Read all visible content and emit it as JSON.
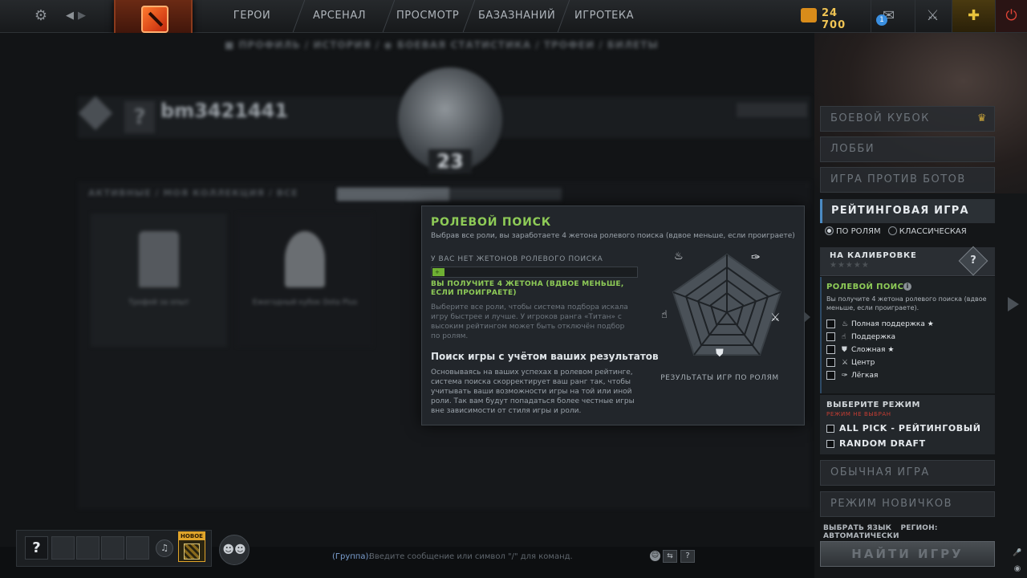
{
  "topbar": {
    "nav": [
      "ГЕРОИ",
      "АРСЕНАЛ",
      "ПРОСМОТР",
      "БАЗАЗНАНИЙ",
      "ИГРОТЕКА"
    ],
    "gold": "24 700",
    "notification_count": "1",
    "icons": {
      "settings": "gear-icon",
      "back": "back-arrow-icon",
      "forward": "forward-arrow-icon",
      "gold": "shards-icon",
      "mail": "mail-icon",
      "armory": "armory-icon",
      "plus": "dota-plus-icon",
      "power": "power-icon"
    }
  },
  "profile": {
    "subnav": "■ ПРОФИЛЬ / ИСТОРИЯ / ◉ БОЕВАЯ СТАТИСТИКА / ТРОФЕИ / БИЛЕТЫ",
    "username": "bm3421441",
    "avatar": "?",
    "rank_number": "23",
    "tabs": "АКТИВНЫЕ / МОЯ КОЛЛЕКЦИЯ / ВСЕ",
    "trophies": [
      "Трофей за опыт",
      "Ежегодный кубок Dota Plus"
    ]
  },
  "tooltip": {
    "title": "РОЛЕВОЙ ПОИСК",
    "subtitle": "Выбрав все роли, вы заработаете 4 жетона ролевого поиска (вдвое меньше, если проиграете)",
    "no_tokens": "У ВАС НЕТ ЖЕТОНОВ РОЛЕВОГО ПОИСКА",
    "bar_value": "+",
    "bar_fraction": 0.06,
    "green_text": "ВЫ ПОЛУЧИТЕ 4 ЖЕТОНА (ВДВОЕ МЕНЬШЕ, ЕСЛИ ПРОИГРАЕТЕ)",
    "gray_text": "Выберите все роли, чтобы система подбора искала игру быстрее и лучше. У игроков ранга «Титан» с высоким рейтингом может быть отключён подбор по ролям.",
    "heading": "Поиск игры с учётом ваших результатов",
    "desc": "Основываясь на ваших успехах в ролевом рейтинге, система поиска скорректирует ваш ранг так, чтобы учитывать ваши возможности игры на той или иной роли. Так вам будут попадаться более честные игры вне зависимости от стиля игры и роли.",
    "radar_label": "РЕЗУЛЬТАТЫ ИГР ПО РОЛЯМ"
  },
  "rightpanel": {
    "battlecup": "БОЕВОЙ КУБОК",
    "lobby": "ЛОББИ",
    "bots": "ИГРА ПРОТИВ БОТОВ",
    "ranked": "РЕЙТИНГОВАЯ ИГРА",
    "by_roles": "ПО РОЛЯМ",
    "classic": "КЛАССИЧЕСКАЯ",
    "calibration": "НА КАЛИБРОВКЕ",
    "calibration_stars": "★★★★★",
    "calibration_badge": "?",
    "role_search_title": "РОЛЕВОЙ ПОИСК",
    "role_search_info": "i",
    "role_search_desc": "Вы получите 4 жетона ролевого поиска (вдвое меньше, если проиграете).",
    "roles": [
      {
        "label": "Полная поддержка",
        "icon": "♨",
        "star": "★"
      },
      {
        "label": "Поддержка",
        "icon": "☝",
        "star": ""
      },
      {
        "label": "Сложная",
        "icon": "⛊",
        "star": "★"
      },
      {
        "label": "Центр",
        "icon": "⚔",
        "star": ""
      },
      {
        "label": "Лёгкая",
        "icon": "✑",
        "star": ""
      }
    ],
    "mode_title": "ВЫБЕРИТЕ РЕЖИМ",
    "mode_subtitle": "РЕЖИМ НЕ ВЫБРАН",
    "modes": [
      "ALL PICK - РЕЙТИНГОВЫЙ",
      "RANDOM DRAFT"
    ],
    "unranked": "ОБЫЧНАЯ ИГРА",
    "newbie": "РЕЖИМ НОВИЧКОВ",
    "language": "ВЫБРАТЬ ЯЗЫК",
    "region": "РЕГИОН: АВТОМАТИЧЕСКИ",
    "find": "НАЙТИ ИГРУ"
  },
  "bottombar": {
    "slot_self": "?",
    "new_badge": "НОВОЕ",
    "chat_group": "(Группа):",
    "chat_placeholder": "Введите сообщение или символ \"/\" для команд."
  }
}
